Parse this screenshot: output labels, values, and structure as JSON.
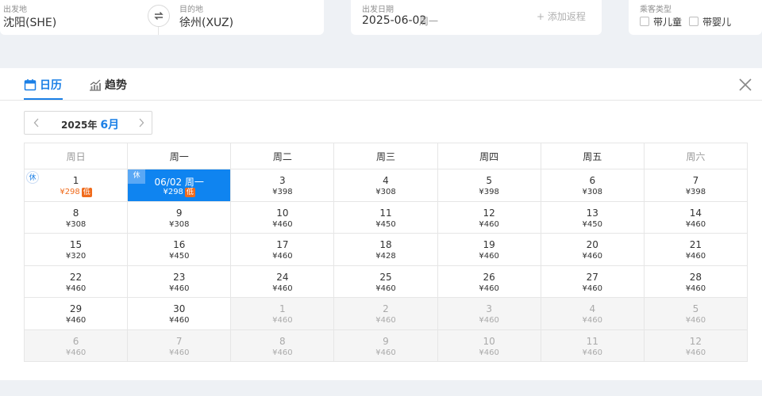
{
  "search": {
    "from_label": "出发地",
    "from_value": "沈阳(SHE)",
    "to_label": "目的地",
    "to_value": "徐州(XUZ)",
    "date_label": "出发日期",
    "date_value": "2025-06-02",
    "date_weekday": "周一",
    "add_return": "+ 添加返程",
    "pax_label": "乘客类型",
    "child_label": "带儿童",
    "infant_label": "带婴儿"
  },
  "tabs": {
    "calendar": "日历",
    "trend": "趋势"
  },
  "month": {
    "year": "2025年",
    "month": "6月"
  },
  "calendar": {
    "headers": [
      "周日",
      "周一",
      "周二",
      "周三",
      "周四",
      "周五",
      "周六"
    ],
    "weeks": [
      [
        {
          "d": "1",
          "p": "¥298",
          "low": true,
          "hol": true
        },
        {
          "d": "06/02 周一",
          "p": "¥298",
          "low": true,
          "hol": true,
          "selected": true
        },
        {
          "d": "3",
          "p": "¥398"
        },
        {
          "d": "4",
          "p": "¥308"
        },
        {
          "d": "5",
          "p": "¥398"
        },
        {
          "d": "6",
          "p": "¥308"
        },
        {
          "d": "7",
          "p": "¥398"
        }
      ],
      [
        {
          "d": "8",
          "p": "¥308"
        },
        {
          "d": "9",
          "p": "¥308"
        },
        {
          "d": "10",
          "p": "¥460"
        },
        {
          "d": "11",
          "p": "¥450"
        },
        {
          "d": "12",
          "p": "¥460"
        },
        {
          "d": "13",
          "p": "¥450"
        },
        {
          "d": "14",
          "p": "¥460"
        }
      ],
      [
        {
          "d": "15",
          "p": "¥320"
        },
        {
          "d": "16",
          "p": "¥450"
        },
        {
          "d": "17",
          "p": "¥460"
        },
        {
          "d": "18",
          "p": "¥428"
        },
        {
          "d": "19",
          "p": "¥460"
        },
        {
          "d": "20",
          "p": "¥460"
        },
        {
          "d": "21",
          "p": "¥460"
        }
      ],
      [
        {
          "d": "22",
          "p": "¥460"
        },
        {
          "d": "23",
          "p": "¥460"
        },
        {
          "d": "24",
          "p": "¥460"
        },
        {
          "d": "25",
          "p": "¥460"
        },
        {
          "d": "26",
          "p": "¥460"
        },
        {
          "d": "27",
          "p": "¥460"
        },
        {
          "d": "28",
          "p": "¥460"
        }
      ],
      [
        {
          "d": "29",
          "p": "¥460"
        },
        {
          "d": "30",
          "p": "¥460"
        },
        {
          "d": "1",
          "p": "¥460",
          "muted": true
        },
        {
          "d": "2",
          "p": "¥460",
          "muted": true
        },
        {
          "d": "3",
          "p": "¥460",
          "muted": true
        },
        {
          "d": "4",
          "p": "¥460",
          "muted": true
        },
        {
          "d": "5",
          "p": "¥460",
          "muted": true
        }
      ],
      [
        {
          "d": "6",
          "p": "¥460",
          "muted": true
        },
        {
          "d": "7",
          "p": "¥460",
          "muted": true
        },
        {
          "d": "8",
          "p": "¥460",
          "muted": true
        },
        {
          "d": "9",
          "p": "¥460",
          "muted": true
        },
        {
          "d": "10",
          "p": "¥460",
          "muted": true
        },
        {
          "d": "11",
          "p": "¥460",
          "muted": true
        },
        {
          "d": "12",
          "p": "¥460",
          "muted": true
        }
      ]
    ],
    "low_badge": "低",
    "holiday_badge": "休"
  },
  "colors": {
    "accent": "#1a7fe6",
    "selected": "#0f84f0",
    "low": "#f06b1c"
  }
}
